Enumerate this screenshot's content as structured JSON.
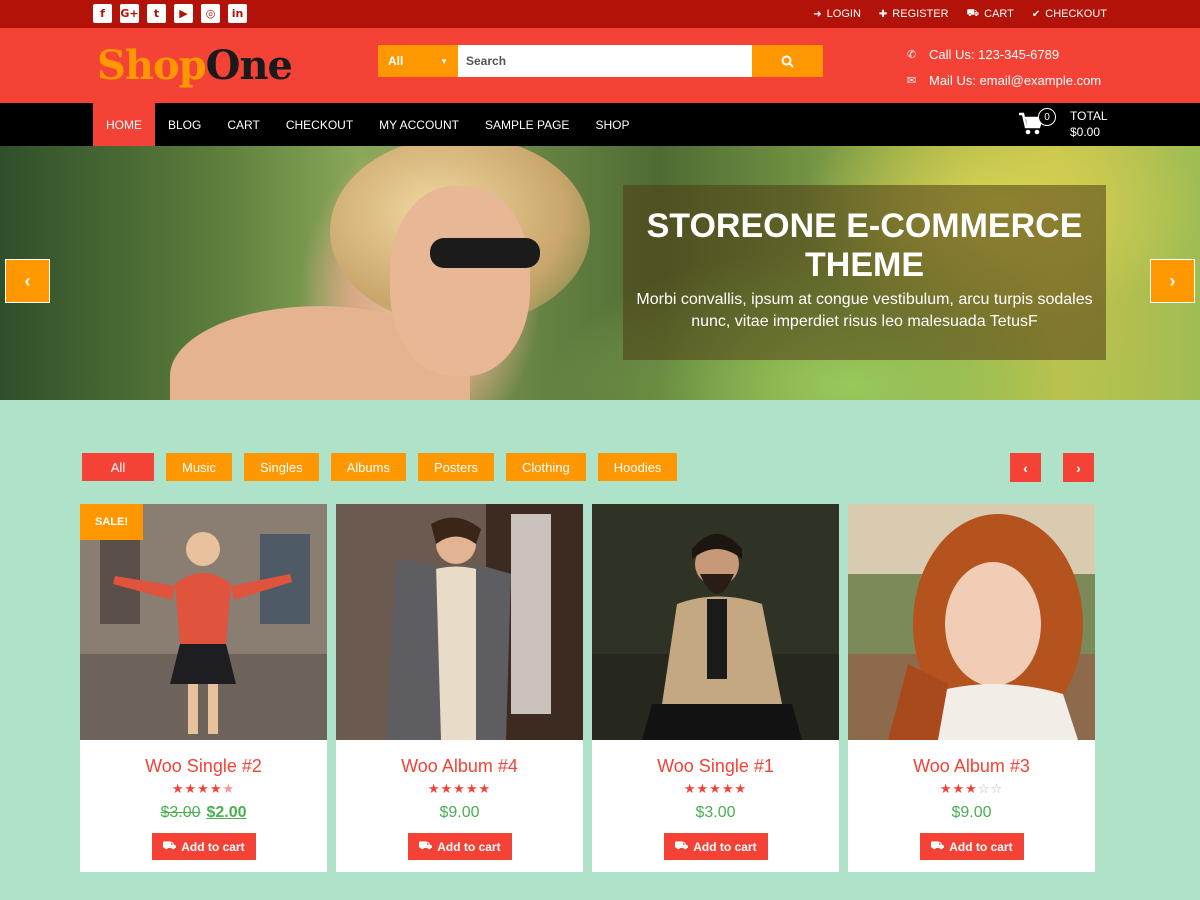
{
  "topbar": {
    "social": [
      {
        "icon": "facebook-icon",
        "glyph": "f"
      },
      {
        "icon": "google-plus-icon",
        "glyph": "G+"
      },
      {
        "icon": "twitter-icon",
        "glyph": "t"
      },
      {
        "icon": "youtube-icon",
        "glyph": "▶"
      },
      {
        "icon": "instagram-icon",
        "glyph": "◎"
      },
      {
        "icon": "linkedin-icon",
        "glyph": "in"
      }
    ],
    "links": [
      {
        "label": "LOGIN",
        "icon": "login-icon",
        "glyph": "➜"
      },
      {
        "label": "REGISTER",
        "icon": "register-icon",
        "glyph": "✚"
      },
      {
        "label": "CART",
        "icon": "basket-icon",
        "glyph": "⛟"
      },
      {
        "label": "CHECKOUT",
        "icon": "checkout-icon",
        "glyph": "✔"
      }
    ]
  },
  "header": {
    "logo_part1": "Shop",
    "logo_part2": "One",
    "search": {
      "category": "All",
      "placeholder": "Search"
    },
    "phone": "Call Us: 123-345-6789",
    "email": "Mail Us: email@example.com"
  },
  "nav": {
    "items": [
      "HOME",
      "BLOG",
      "CART",
      "CHECKOUT",
      "MY ACCOUNT",
      "SAMPLE PAGE",
      "SHOP"
    ],
    "active_index": 0,
    "cart_count": "0",
    "total_label": "TOTAL",
    "total_value": "$0.00"
  },
  "hero": {
    "title": "STOREONE E-COMMERCE THEME",
    "text": "Morbi convallis, ipsum at congue vestibulum, arcu turpis sodales nunc, vitae imperdiet risus leo malesuada TetusF"
  },
  "filters": [
    "All",
    "Music",
    "Singles",
    "Albums",
    "Posters",
    "Clothing",
    "Hoodies"
  ],
  "products": [
    {
      "title": "Woo Single #2",
      "rating": 4.5,
      "old_price": "$3.00",
      "price": "$2.00",
      "sale": "SALE!",
      "button": "Add to cart"
    },
    {
      "title": "Woo Album #4",
      "rating": 5,
      "old_price": "",
      "price": "$9.00",
      "sale": "",
      "button": "Add to cart"
    },
    {
      "title": "Woo Single #1",
      "rating": 5,
      "old_price": "",
      "price": "$3.00",
      "sale": "",
      "button": "Add to cart"
    },
    {
      "title": "Woo Album #3",
      "rating": 3,
      "old_price": "",
      "price": "$9.00",
      "sale": "",
      "button": "Add to cart"
    }
  ],
  "colors": {
    "primary": "#f44336",
    "accent": "#ff9800",
    "topbar": "#b31208",
    "page_bg": "#aee2c9",
    "price": "#4caf50"
  }
}
